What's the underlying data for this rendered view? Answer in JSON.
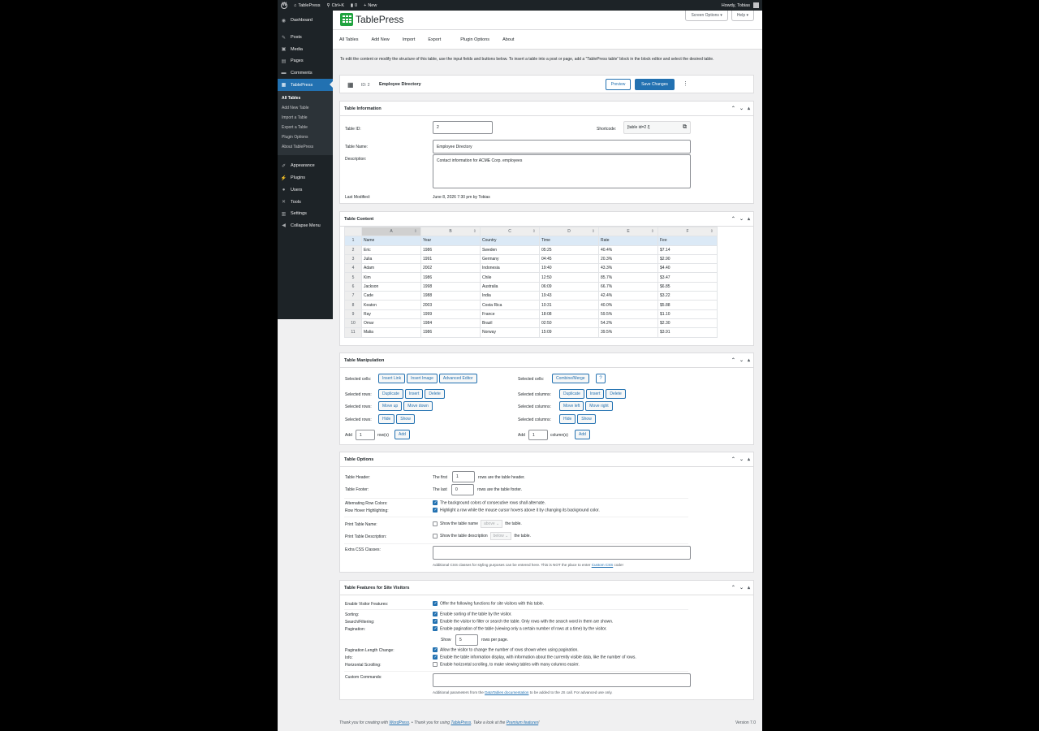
{
  "adminbar": {
    "site_name": "TablePress",
    "search_shortcut": "Ctrl+K",
    "comments_count": "0",
    "new_label": "New",
    "howdy": "Howdy, Tobias"
  },
  "sidebar": {
    "items_top": [
      {
        "label": "Dashboard",
        "icon": "dashboard-icon"
      },
      {
        "label": "Posts",
        "icon": "pin-icon"
      },
      {
        "label": "Media",
        "icon": "media-icon"
      },
      {
        "label": "Pages",
        "icon": "pages-icon"
      },
      {
        "label": "Comments",
        "icon": "comments-icon"
      },
      {
        "label": "TablePress",
        "icon": "tablepress-icon"
      }
    ],
    "submenu": [
      "All Tables",
      "Add New Table",
      "Import a Table",
      "Export a Table",
      "Plugin Options",
      "About TablePress"
    ],
    "items_bottom": [
      {
        "label": "Appearance",
        "icon": "brush-icon"
      },
      {
        "label": "Plugins",
        "icon": "plugin-icon"
      },
      {
        "label": "Users",
        "icon": "users-icon"
      },
      {
        "label": "Tools",
        "icon": "tools-icon"
      },
      {
        "label": "Settings",
        "icon": "settings-icon"
      },
      {
        "label": "Collapse Menu",
        "icon": "collapse-icon"
      }
    ]
  },
  "header": {
    "logo_text": "TablePress",
    "screen_options": "Screen Options ▾",
    "help": "Help ▾"
  },
  "nav_tabs": [
    "All Tables",
    "Add New",
    "Import",
    "Export",
    "Plugin Options",
    "About"
  ],
  "intro": "To edit the content or modify the structure of this table, use the input fields and buttons below. To insert a table into a post or page, add a “TablePress table” block in the block editor and select the desired table.",
  "titlebar": {
    "id_label": "ID: 2",
    "name": "Employee Directory",
    "preview": "Preview",
    "save": "Save Changes"
  },
  "table_info": {
    "title": "Table Information",
    "id_label": "Table ID:",
    "id_value": "2",
    "shortcode_label": "Shortcode:",
    "shortcode_value": "[table id=2 /]",
    "name_label": "Table Name:",
    "name_value": "Employee Directory",
    "desc_label": "Description:",
    "desc_value": "Contact information for ACME Corp. employees",
    "modified_label": "Last Modified:",
    "modified_value": "June 8, 2026 7:30 pm by Tobias"
  },
  "table_content": {
    "title": "Table Content",
    "columns": [
      "A",
      "B",
      "C",
      "D",
      "E",
      "F"
    ],
    "rows": [
      [
        "1",
        "Name",
        "Year",
        "Country",
        "Time",
        "Rate",
        "Fee"
      ],
      [
        "2",
        "Eric",
        "1986",
        "Sweden",
        "05:25",
        "40.4%",
        "$7.14"
      ],
      [
        "3",
        "Julia",
        "1991",
        "Germany",
        "04:45",
        "20.3%",
        "$2.90"
      ],
      [
        "4",
        "Adam",
        "2002",
        "Indonesia",
        "19:40",
        "43.3%",
        "$4.40"
      ],
      [
        "5",
        "Kim",
        "1986",
        "Chile",
        "12:50",
        "85.7%",
        "$3.47"
      ],
      [
        "6",
        "Jackson",
        "1998",
        "Australia",
        "06:09",
        "66.7%",
        "$6.85"
      ],
      [
        "7",
        "Cade",
        "1988",
        "India",
        "19:43",
        "42.4%",
        "$3.22"
      ],
      [
        "8",
        "Keaton",
        "2003",
        "Costa Rica",
        "10:31",
        "40.0%",
        "$5.88"
      ],
      [
        "9",
        "Ray",
        "1999",
        "France",
        "18:08",
        "59.5%",
        "$1.10"
      ],
      [
        "10",
        "Omar",
        "1984",
        "Brazil",
        "02:50",
        "54.2%",
        "$2.30"
      ],
      [
        "11",
        "Malia",
        "1986",
        "Norway",
        "15:09",
        "39.5%",
        "$3.91"
      ]
    ]
  },
  "manipulation": {
    "title": "Table Manipulation",
    "selected_cells": "Selected cells:",
    "insert_link": "Insert Link",
    "insert_image": "Insert Image",
    "advanced_editor": "Advanced Editor",
    "combine_merge": "Combine/Merge",
    "help": "?",
    "selected_rows": "Selected rows:",
    "selected_columns": "Selected columns:",
    "duplicate": "Duplicate",
    "insert": "Insert",
    "delete": "Delete",
    "move_up": "Move up",
    "move_down": "Move down",
    "move_left": "Move left",
    "move_right": "Move right",
    "hide": "Hide",
    "show": "Show",
    "add": "Add",
    "rows_value": "1",
    "rows_suffix": "row(s)",
    "cols_value": "1",
    "cols_suffix": "column(s)"
  },
  "options": {
    "title": "Table Options",
    "header_label": "Table Header:",
    "header_pre": "The first",
    "header_value": "1",
    "header_post": "rows are the table header.",
    "footer_label": "Table Footer:",
    "footer_pre": "The last",
    "footer_value": "0",
    "footer_post": "rows are the table footer.",
    "alt_label": "Alternating Row Colors:",
    "alt_text": "The background colors of consecutive rows shall alternate.",
    "hover_label": "Row Hover Highlighting:",
    "hover_text": "Highlight a row while the mouse cursor hovers above it by changing its background color.",
    "print_name_label": "Print Table Name:",
    "print_name_text": "Show the table name",
    "print_name_select": "above",
    "print_name_post": "the table.",
    "print_desc_label": "Print Table Description:",
    "print_desc_text": "Show the table description",
    "print_desc_select": "below",
    "print_desc_post": "the table.",
    "css_label": "Extra CSS Classes:",
    "css_help_pre": "Additional CSS classes for styling purposes can be entered here. This is NOT the place to enter",
    "css_help_link": "Custom CSS",
    "css_help_post": "code!"
  },
  "features": {
    "title": "Table Features for Site Visitors",
    "enable_label": "Enable Visitor Features:",
    "enable_text": "Offer the following functions for site visitors with this table.",
    "sorting_label": "Sorting:",
    "sorting_text": "Enable sorting of the table by the visitor.",
    "search_label": "Search/Filtering:",
    "search_text": "Enable the visitor to filter or search the table. Only rows with the search word in them are shown.",
    "pagination_label": "Pagination:",
    "pagination_text": "Enable pagination of the table (viewing only a certain number of rows at a time) by the visitor.",
    "show_pre": "Show",
    "show_value": "5",
    "show_post": "rows per page.",
    "plc_label": "Pagination Length Change:",
    "plc_text": "Allow the visitor to change the number of rows shown when using pagination.",
    "info_label": "Info:",
    "info_text": "Enable the table information display, with information about the currently visible data, like the number of rows.",
    "hscroll_label": "Horizontal Scrolling:",
    "hscroll_text": "Enable horizontal scrolling, to make viewing tables with many columns easier.",
    "custom_label": "Custom Commands:",
    "custom_help_pre": "Additional parameters from the",
    "custom_help_link": "DataTables documentation",
    "custom_help_post": "to be added to the JS call. For advanced use only."
  },
  "footer": {
    "thanks_pre": "Thank you for creating with",
    "wp_link": "WordPress",
    "thanks_mid": ". • Thank you for using",
    "tp_link": "TablePress",
    "thanks_post": ". Take a look at the",
    "premium_link": "Premium features",
    "thanks_end": "!",
    "version": "Version 7.0"
  }
}
